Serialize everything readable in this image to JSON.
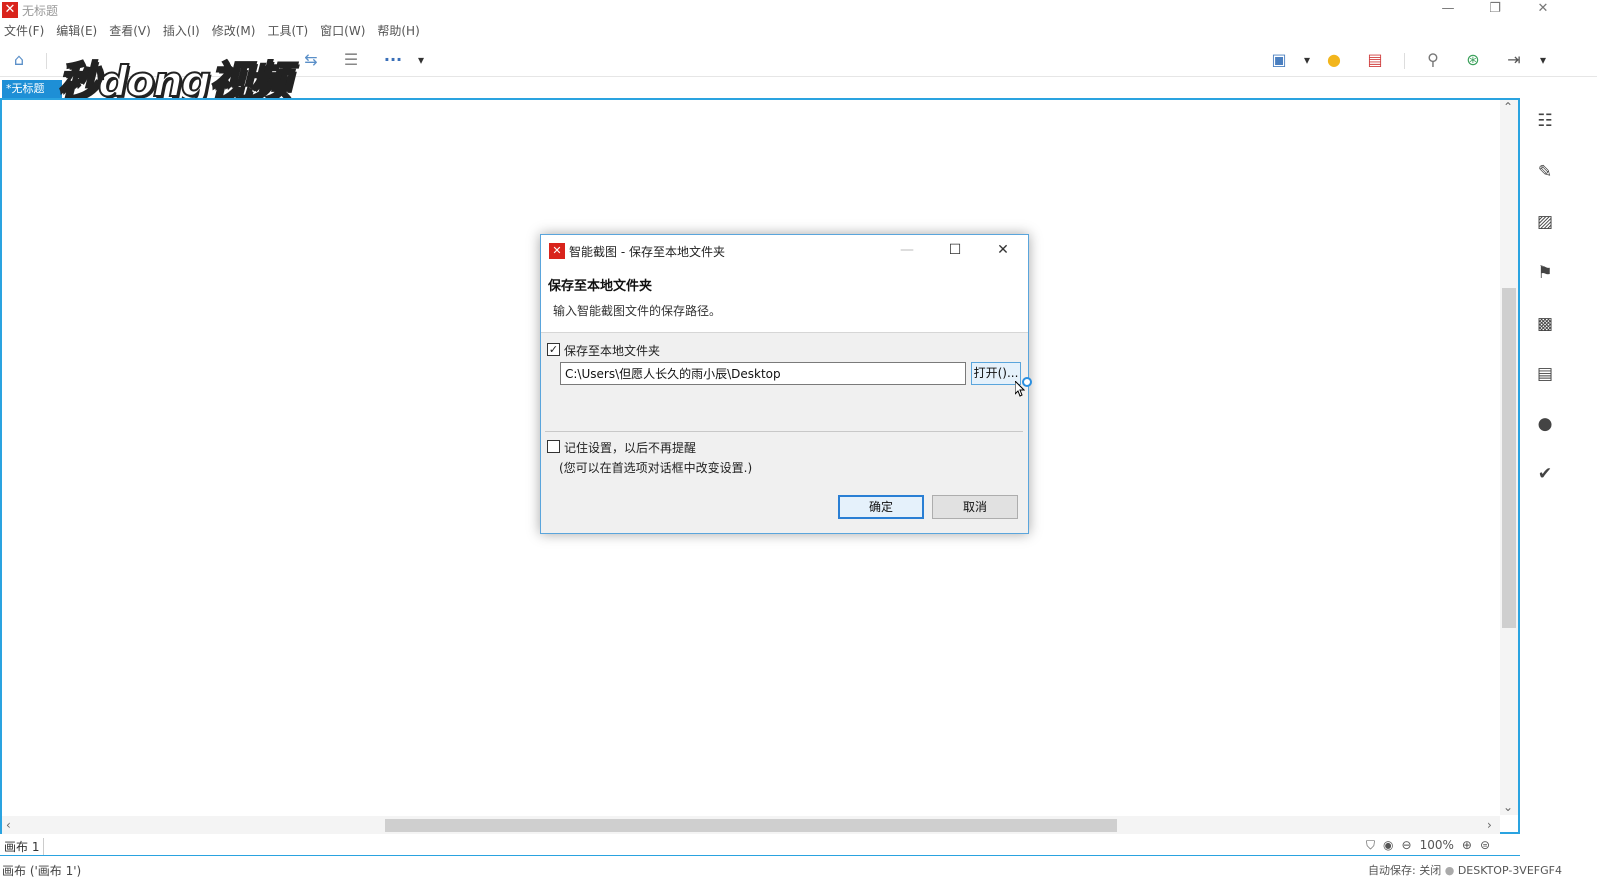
{
  "window": {
    "title": "无标题",
    "minimize": "—",
    "restore": "❐",
    "close": "✕"
  },
  "menu": [
    "文件(F)",
    "编辑(E)",
    "查看(V)",
    "插入(I)",
    "修改(M)",
    "工具(T)",
    "窗口(W)",
    "帮助(H)"
  ],
  "toolbar": {
    "more": "···",
    "dropdown": "▾"
  },
  "doc_tab": "*无标题",
  "watermark": "秒dong视频",
  "sheet_tab": "画布 1",
  "zoom": "100%",
  "status": {
    "left": "画布 ('画布 1')",
    "autosave": "自动保存: 关闭",
    "machine": "DESKTOP-3VEFGF4"
  },
  "dialog": {
    "title": "智能截图 - 保存至本地文件夹",
    "heading": "保存至本地文件夹",
    "description": "输入智能截图文件的保存路径。",
    "save_local_label": "保存至本地文件夹",
    "save_local_checked": true,
    "path_value": "C:\\Users\\但愿人长久的雨小辰\\Desktop",
    "open_button": "打开()...",
    "remember_label": "记住设置，以后不再提醒",
    "remember_checked": false,
    "note": "(您可以在首选项对话框中改变设置.)",
    "ok": "确定",
    "cancel": "取消",
    "minimize": "—",
    "maximize": "☐",
    "close": "✕"
  }
}
